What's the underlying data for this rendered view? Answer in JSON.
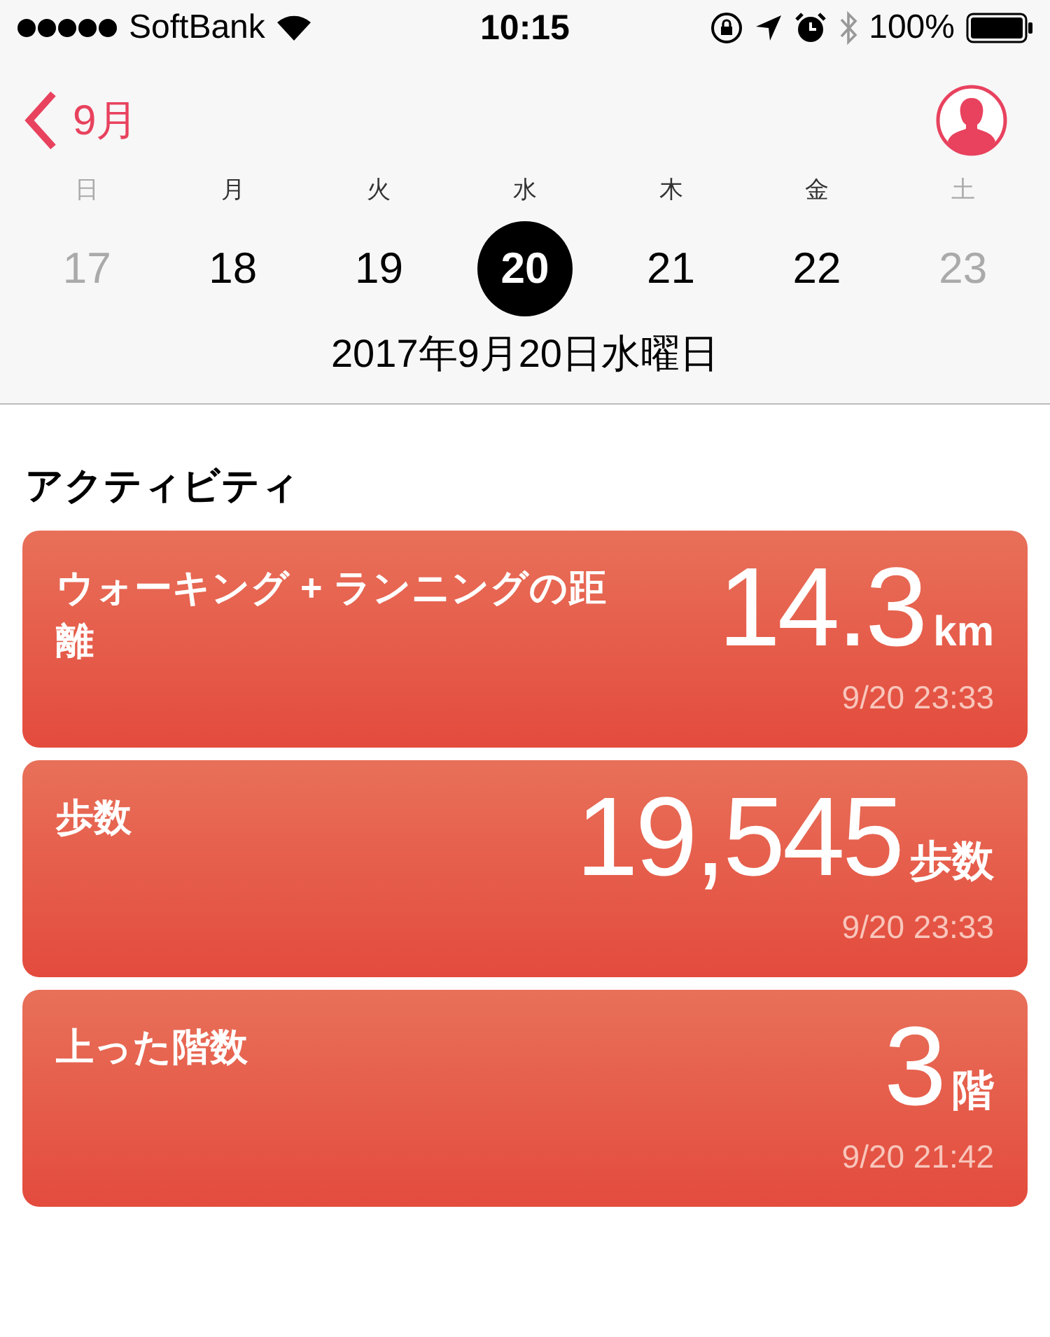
{
  "status_bar": {
    "carrier": "SoftBank",
    "time": "10:15",
    "battery": "100%"
  },
  "nav": {
    "back_label": "9月"
  },
  "week": [
    {
      "weekday": "日",
      "day": "17",
      "selected": false,
      "dimmed": true
    },
    {
      "weekday": "月",
      "day": "18",
      "selected": false,
      "dimmed": false
    },
    {
      "weekday": "火",
      "day": "19",
      "selected": false,
      "dimmed": false
    },
    {
      "weekday": "水",
      "day": "20",
      "selected": true,
      "dimmed": false
    },
    {
      "weekday": "木",
      "day": "21",
      "selected": false,
      "dimmed": false
    },
    {
      "weekday": "金",
      "day": "22",
      "selected": false,
      "dimmed": false
    },
    {
      "weekday": "土",
      "day": "23",
      "selected": false,
      "dimmed": true
    }
  ],
  "full_date": "2017年9月20日水曜日",
  "section_title": "アクティビティ",
  "cards": [
    {
      "title": "ウォーキング + ランニングの距離",
      "value": "14.3",
      "unit": "km",
      "timestamp": "9/20 23:33"
    },
    {
      "title": "歩数",
      "value": "19,545",
      "unit": "歩数",
      "timestamp": "9/20 23:33"
    },
    {
      "title": "上った階数",
      "value": "3",
      "unit": "階",
      "timestamp": "9/20 21:42"
    }
  ]
}
